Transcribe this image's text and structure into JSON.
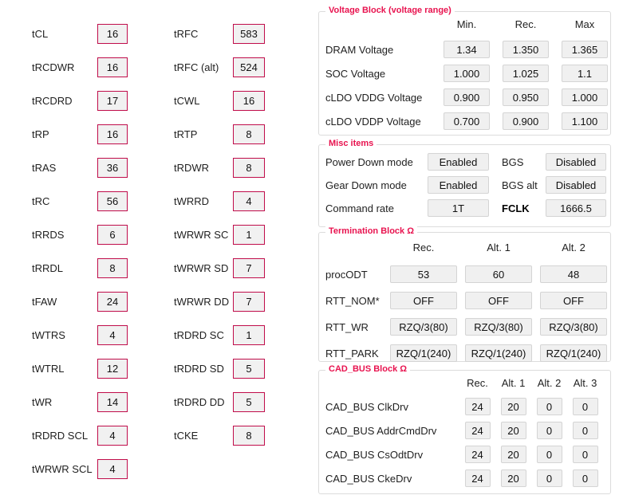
{
  "colors": {
    "accent_border": "#c00c4a",
    "group_title": "#e8134f",
    "button_bg": "#f0f0f0",
    "button_border": "#d4d4d4"
  },
  "timings_left": [
    {
      "label": "tCL",
      "value": "16"
    },
    {
      "label": "tRCDWR",
      "value": "16"
    },
    {
      "label": "tRCDRD",
      "value": "17"
    },
    {
      "label": "tRP",
      "value": "16"
    },
    {
      "label": "tRAS",
      "value": "36"
    },
    {
      "label": "tRC",
      "value": "56"
    },
    {
      "label": "tRRDS",
      "value": "6"
    },
    {
      "label": "tRRDL",
      "value": "8"
    },
    {
      "label": "tFAW",
      "value": "24"
    },
    {
      "label": "tWTRS",
      "value": "4"
    },
    {
      "label": "tWTRL",
      "value": "12"
    },
    {
      "label": "tWR",
      "value": "14"
    },
    {
      "label": "tRDRD SCL",
      "value": "4"
    },
    {
      "label": "tWRWR SCL",
      "value": "4"
    }
  ],
  "timings_mid": [
    {
      "label": "tRFC",
      "value": "583"
    },
    {
      "label": "tRFC (alt)",
      "value": "524"
    },
    {
      "label": "tCWL",
      "value": "16"
    },
    {
      "label": "tRTP",
      "value": "8"
    },
    {
      "label": "tRDWR",
      "value": "8"
    },
    {
      "label": "tWRRD",
      "value": "4"
    },
    {
      "label": "tWRWR SC",
      "value": "1"
    },
    {
      "label": "tWRWR SD",
      "value": "7"
    },
    {
      "label": "tWRWR DD",
      "value": "7"
    },
    {
      "label": "tRDRD SC",
      "value": "1"
    },
    {
      "label": "tRDRD SD",
      "value": "5"
    },
    {
      "label": "tRDRD DD",
      "value": "5"
    },
    {
      "label": "tCKE",
      "value": "8"
    }
  ],
  "voltage_block": {
    "title": "Voltage Block (voltage range)",
    "headers": [
      "Min.",
      "Rec.",
      "Max"
    ],
    "rows": [
      {
        "label": "DRAM Voltage",
        "values": [
          "1.34",
          "1.350",
          "1.365"
        ]
      },
      {
        "label": "SOC Voltage",
        "values": [
          "1.000",
          "1.025",
          "1.1"
        ]
      },
      {
        "label": "cLDO VDDG Voltage",
        "values": [
          "0.900",
          "0.950",
          "1.000"
        ]
      },
      {
        "label": "cLDO VDDP Voltage",
        "values": [
          "0.700",
          "0.900",
          "1.100"
        ]
      }
    ]
  },
  "misc_block": {
    "title": "Misc items",
    "rows": [
      {
        "label": "Power Down mode",
        "value": "Enabled",
        "label2": "BGS",
        "value2": "Disabled"
      },
      {
        "label": "Gear Down mode",
        "value": "Enabled",
        "label2": "BGS alt",
        "value2": "Disabled"
      },
      {
        "label": "Command rate",
        "value": "1T",
        "label2": "FCLK",
        "value2": "1666.5"
      }
    ]
  },
  "termination_block": {
    "title": "Termination Block Ω",
    "headers": [
      "Rec.",
      "Alt. 1",
      "Alt. 2"
    ],
    "rows": [
      {
        "label": "procODT",
        "values": [
          "53",
          "60",
          "48"
        ]
      },
      {
        "label": "RTT_NOM*",
        "values": [
          "OFF",
          "OFF",
          "OFF"
        ]
      },
      {
        "label": "RTT_WR",
        "values": [
          "RZQ/3(80)",
          "RZQ/3(80)",
          "RZQ/3(80)"
        ]
      },
      {
        "label": "RTT_PARK",
        "values": [
          "RZQ/1(240)",
          "RZQ/1(240)",
          "RZQ/1(240)"
        ]
      }
    ]
  },
  "cad_bus_block": {
    "title": "CAD_BUS Block Ω",
    "headers": [
      "Rec.",
      "Alt. 1",
      "Alt. 2",
      "Alt. 3"
    ],
    "rows": [
      {
        "label": "CAD_BUS ClkDrv",
        "values": [
          "24",
          "20",
          "0",
          "0"
        ]
      },
      {
        "label": "CAD_BUS AddrCmdDrv",
        "values": [
          "24",
          "20",
          "0",
          "0"
        ]
      },
      {
        "label": "CAD_BUS CsOdtDrv",
        "values": [
          "24",
          "20",
          "0",
          "0"
        ]
      },
      {
        "label": "CAD_BUS CkeDrv",
        "values": [
          "24",
          "20",
          "0",
          "0"
        ]
      }
    ]
  }
}
